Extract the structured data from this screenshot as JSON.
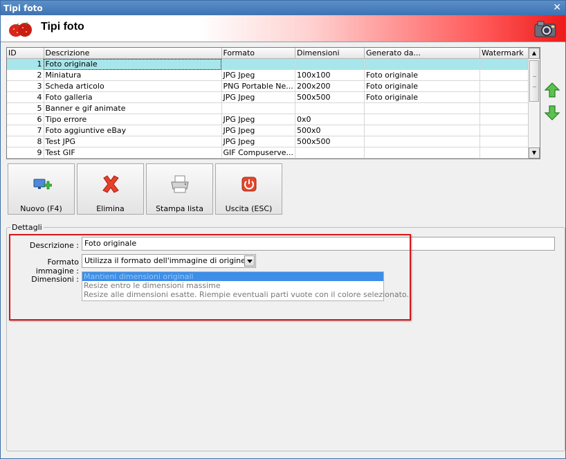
{
  "window": {
    "title": "Tipi foto"
  },
  "header": {
    "title": "Tipi foto"
  },
  "grid": {
    "columns": [
      "ID",
      "Descrizione",
      "Formato",
      "Dimensioni",
      "Generato da...",
      "Watermark"
    ],
    "rows": [
      {
        "id": "1",
        "descrizione": "Foto originale",
        "formato": "",
        "dimensioni": "",
        "generato": "",
        "watermark": ""
      },
      {
        "id": "2",
        "descrizione": "Miniatura",
        "formato": "JPG Jpeg",
        "dimensioni": "100x100",
        "generato": "Foto originale",
        "watermark": ""
      },
      {
        "id": "3",
        "descrizione": "Scheda articolo",
        "formato": "PNG Portable Ne...",
        "dimensioni": "200x200",
        "generato": "Foto originale",
        "watermark": ""
      },
      {
        "id": "4",
        "descrizione": "Foto galleria",
        "formato": "JPG Jpeg",
        "dimensioni": "500x500",
        "generato": "Foto originale",
        "watermark": ""
      },
      {
        "id": "5",
        "descrizione": "Banner e gif animate",
        "formato": "",
        "dimensioni": "",
        "generato": "",
        "watermark": ""
      },
      {
        "id": "6",
        "descrizione": "Tipo errore",
        "formato": "JPG Jpeg",
        "dimensioni": "0x0",
        "generato": "",
        "watermark": ""
      },
      {
        "id": "7",
        "descrizione": "Foto aggiuntive eBay",
        "formato": "JPG Jpeg",
        "dimensioni": "500x0",
        "generato": "",
        "watermark": ""
      },
      {
        "id": "8",
        "descrizione": "Test JPG",
        "formato": "JPG Jpeg",
        "dimensioni": "500x500",
        "generato": "",
        "watermark": ""
      },
      {
        "id": "9",
        "descrizione": "Test GIF",
        "formato": "GIF Compuserve...",
        "dimensioni": "",
        "generato": "",
        "watermark": ""
      }
    ]
  },
  "toolbar": {
    "new_label": "Nuovo (F4)",
    "delete_label": "Elimina",
    "print_label": "Stampa lista",
    "exit_label": "Uscita (ESC)"
  },
  "details": {
    "group_title": "Dettagli",
    "descrizione_label": "Descrizione :",
    "descrizione_value": "Foto originale",
    "formato_label": "Formato immagine :",
    "formato_value": "Utilizza il formato dell'immagine di origine",
    "dimensioni_label": "Dimensioni :",
    "dimensioni_options": [
      "Mantieni dimensioni originali",
      "Resize entro le dimensioni massime",
      "Resize alle dimensioni esatte. Riempie eventuali parti vuote con il colore selezionato."
    ]
  },
  "colors": {
    "selection_row": "#a7e6ea",
    "header_red": "#ee1b1b",
    "highlight_box": "#d81515",
    "list_selection": "#3d8ee8"
  },
  "icons": {
    "close": "close-icon",
    "logo": "strawberry-logo-icon",
    "camera": "camera-icon",
    "move_up": "arrow-up-icon",
    "move_down": "arrow-down-icon",
    "new": "add-monitor-icon",
    "delete": "red-x-icon",
    "print": "printer-icon",
    "exit": "power-icon"
  }
}
